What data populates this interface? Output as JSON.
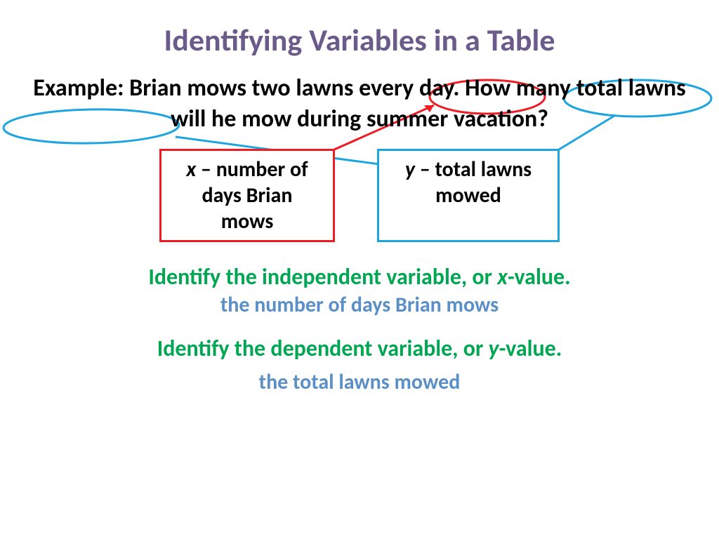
{
  "title": "Identifying Variables in a Table",
  "example": "Example: Brian mows two lawns every day. How many total lawns will he mow during summer vacation?",
  "boxX": {
    "var": "x",
    "text": " – number of days Brian mows"
  },
  "boxY": {
    "var": "y",
    "text": " – total lawns mowed"
  },
  "instr1": {
    "pre": "Identify the independent variable, or ",
    "var": "x",
    "post": "-value."
  },
  "ans1": "the number of days Brian mows",
  "instr2": {
    "pre": "Identify the dependent variable, or ",
    "var": "y",
    "post": "-value."
  },
  "ans2": "the total lawns mowed"
}
